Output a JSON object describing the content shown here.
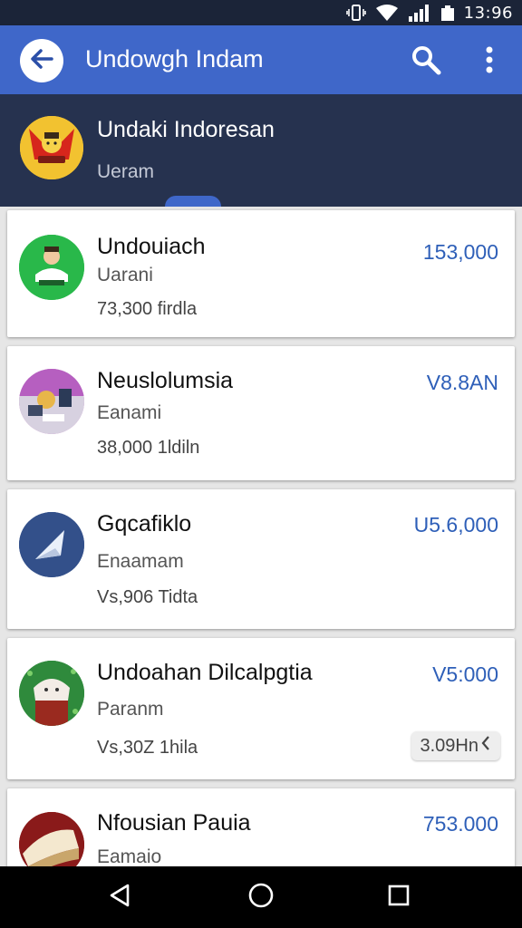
{
  "status_bar": {
    "time": "13:96",
    "icons": [
      "vibrate-icon",
      "wifi-icon",
      "signal-icon",
      "battery-icon"
    ]
  },
  "app_bar": {
    "title": "Undowgh Indam",
    "back_icon": "arrow-left-icon",
    "search_icon": "search-icon",
    "more_icon": "more-vert-icon"
  },
  "header": {
    "title": "Undaki Indoresan",
    "subtitle": "Ueram"
  },
  "colors": {
    "status_bar": "#1b2438",
    "app_bar": "#3f67c9",
    "header": "#26324f",
    "amount": "#2e5fb8"
  },
  "items": [
    {
      "title": "Undouiach",
      "subtitle": "Uarani",
      "meta": "73,300 firdla",
      "amount": "153,000"
    },
    {
      "title": "Neuslolumsia",
      "subtitle": "Eanami",
      "meta": "38,000 1ldiln",
      "amount": "V8.8AN"
    },
    {
      "title": "Gqcafiklo",
      "subtitle": "Enaamam",
      "meta": "Vs,906 Tidta",
      "amount": "U5.6,000"
    },
    {
      "title": "Undoahan Dilcalpgtia",
      "subtitle": "Paranm",
      "meta": "Vs,30Z 1hila",
      "amount": "V5:000",
      "badge": "3.09Hn"
    },
    {
      "title": "Nfousian Pauia",
      "subtitle": "Eamaio",
      "meta": "",
      "amount": "753.000"
    }
  ],
  "nav_bar": {
    "icons": [
      "back-triangle-icon",
      "home-circle-icon",
      "recents-square-icon"
    ]
  }
}
